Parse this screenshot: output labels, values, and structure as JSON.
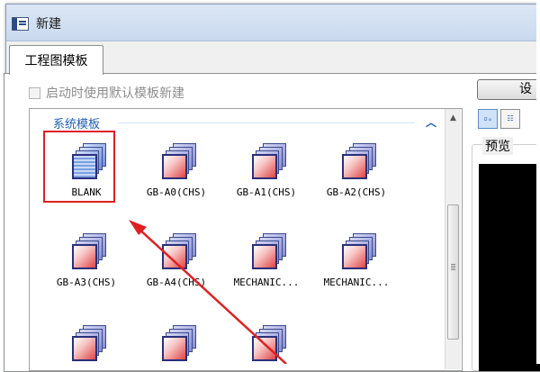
{
  "window": {
    "title": "新建"
  },
  "tabs": [
    {
      "label": "工程图模板",
      "selected": true
    }
  ],
  "checkbox": {
    "label": "启动时使用默认模板新建",
    "checked": false,
    "enabled": false
  },
  "group": {
    "label": "系统模板",
    "collapse_icon": "chevron-up-icon",
    "items": [
      {
        "label": "BLANK",
        "selected": true
      },
      {
        "label": "GB-A0(CHS)"
      },
      {
        "label": "GB-A1(CHS)"
      },
      {
        "label": "GB-A2(CHS)"
      },
      {
        "label": "GB-A3(CHS)"
      },
      {
        "label": "GB-A4(CHS)"
      },
      {
        "label": "MECHANIC..."
      },
      {
        "label": "MECHANIC..."
      },
      {
        "label": ""
      },
      {
        "label": ""
      },
      {
        "label": ""
      }
    ]
  },
  "right_panel": {
    "button_label": "设",
    "view_buttons": [
      {
        "name": "large-icon-view",
        "glyph": "▫ₒ",
        "active": true
      },
      {
        "name": "list-view",
        "glyph": "☷",
        "active": false
      }
    ],
    "preview_label": "预览"
  },
  "colors": {
    "accent": "#1e5fb5",
    "highlight": "#e02020",
    "preview_bg": "#000000"
  }
}
